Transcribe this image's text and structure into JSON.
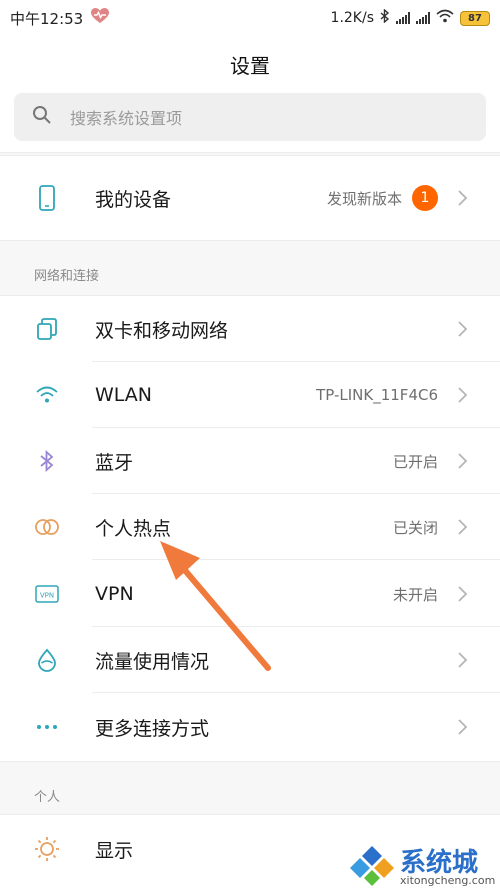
{
  "status": {
    "time": "中午12:53",
    "speed": "1.2K/s",
    "battery": "87"
  },
  "title": "设置",
  "search": {
    "placeholder": "搜索系统设置项"
  },
  "device": {
    "label": "我的设备",
    "value": "发现新版本",
    "badge": "1"
  },
  "network_section": {
    "title": "网络和连接",
    "items": [
      {
        "label": "双卡和移动网络",
        "value": ""
      },
      {
        "label": "WLAN",
        "value": "TP-LINK_11F4C6"
      },
      {
        "label": "蓝牙",
        "value": "已开启"
      },
      {
        "label": "个人热点",
        "value": "已关闭"
      },
      {
        "label": "VPN",
        "value": "未开启"
      },
      {
        "label": "流量使用情况",
        "value": ""
      },
      {
        "label": "更多连接方式",
        "value": ""
      }
    ]
  },
  "personal_section": {
    "title": "个人",
    "items": [
      {
        "label": "显示",
        "value": ""
      }
    ]
  },
  "icons": {
    "accent": "#2fa6b8",
    "bluetooth": "#9b86d6",
    "hotspot": "#e6a060",
    "display": "#e6a060",
    "arrow": "#f07a3c"
  },
  "watermark": {
    "text": "系统城",
    "url": "xitongcheng.com"
  }
}
